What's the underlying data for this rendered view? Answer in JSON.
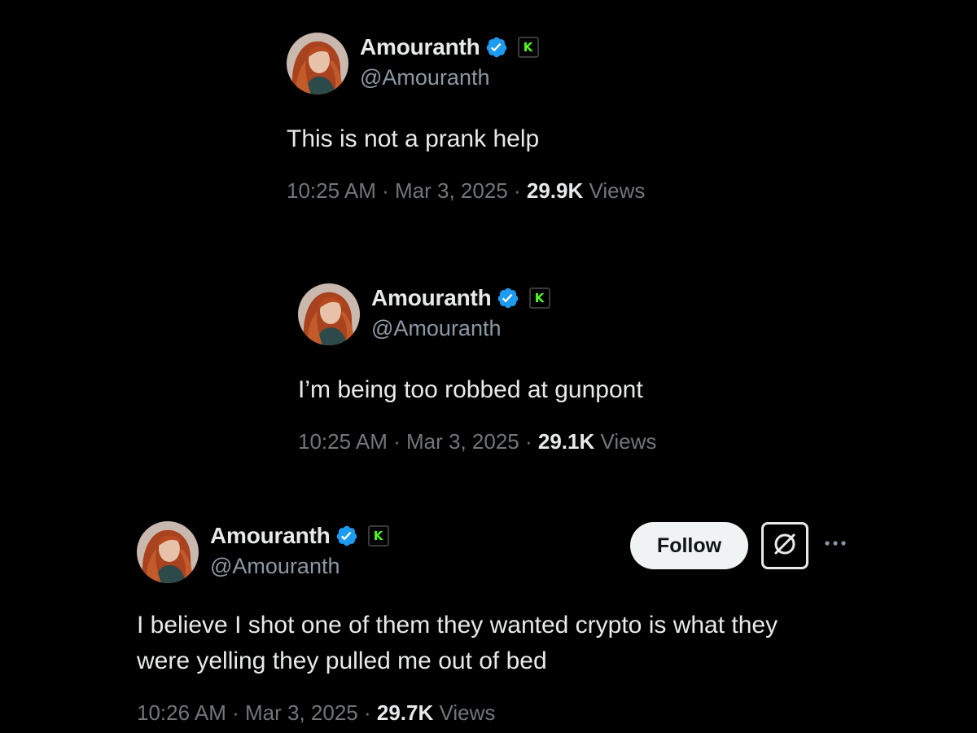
{
  "tweets": [
    {
      "name": "Amouranth",
      "handle": "@Amouranth",
      "text_lines": [
        "This is not a prank help"
      ],
      "time": "10:25 AM",
      "date": "Mar 3, 2025",
      "views_count": "29.9K",
      "views_label": "Views"
    },
    {
      "name": "Amouranth",
      "handle": "@Amouranth",
      "text_lines": [
        "I’m being too robbed at gunpont"
      ],
      "time": "10:25 AM",
      "date": "Mar 3, 2025",
      "views_count": "29.1K",
      "views_label": "Views"
    },
    {
      "name": "Amouranth",
      "handle": "@Amouranth",
      "text_lines": [
        "I believe I shot one of them they wanted crypto is what they",
        "were yelling they pulled me out of bed"
      ],
      "time": "10:26 AM",
      "date": "Mar 3, 2025",
      "views_count": "29.7K",
      "views_label": "Views"
    }
  ],
  "separator": "·",
  "actions": {
    "follow_label": "Follow",
    "grok_icon": "grok-icon",
    "more_icon": "more-options-icon"
  },
  "icons": {
    "verified": "verified-badge-icon",
    "kick": "kick-badge-icon"
  },
  "colors": {
    "background": "#000000",
    "text": "#e7e9ea",
    "muted": "#71767b",
    "verified": "#1d9bf0",
    "kick_green": "#53fc18",
    "follow_bg": "#eff3f4"
  }
}
